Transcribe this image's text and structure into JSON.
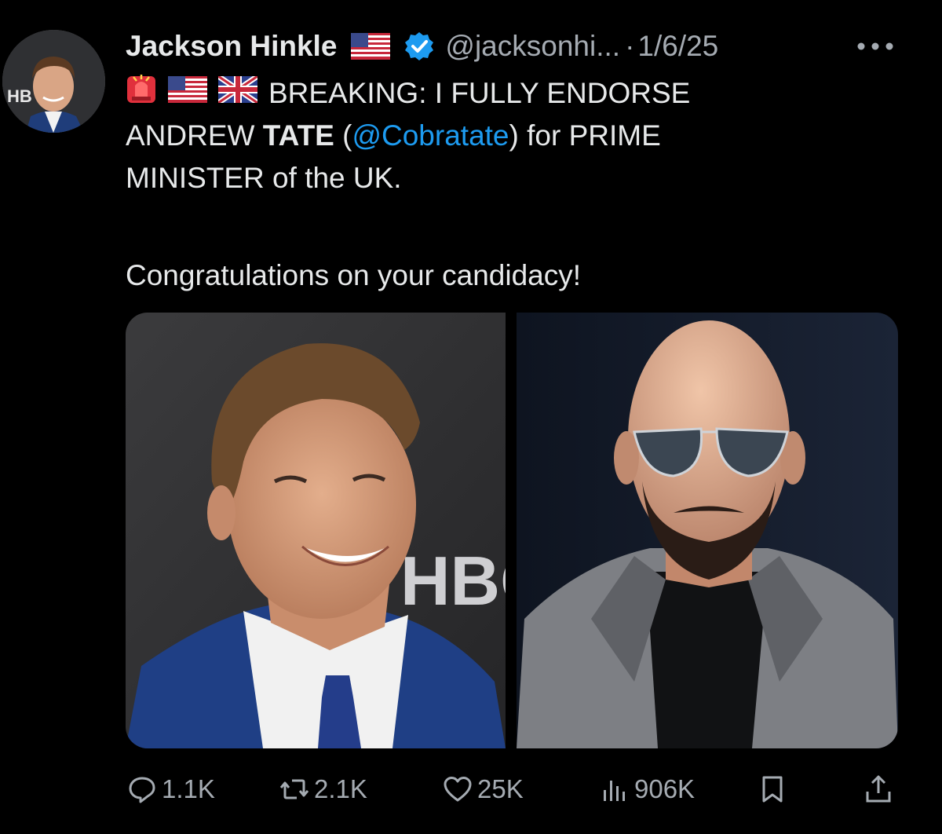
{
  "tweet": {
    "author": {
      "display_name": "Jackson Hinkle",
      "handle": "@jacksonhi...",
      "separator": "·",
      "date": "1/6/25"
    },
    "text": {
      "line1": "BREAKING: I FULLY ENDORSE",
      "line2_prefix": "ANDREW ",
      "line2_bold": "TATE",
      "line2_open": " (",
      "line2_mention": "@Cobratate",
      "line2_suffix": ") for PRIME",
      "line3": "MINISTER of the UK.",
      "line4": "Congratulations on your candidacy!"
    },
    "avatar_logo_text": "HB",
    "left_photo_logo_text": "HBO",
    "actions": {
      "replies": "1.1K",
      "reposts": "2.1K",
      "likes": "25K",
      "views": "906K"
    },
    "icons": {
      "verified": "verified-badge-icon",
      "more": "more-options-icon",
      "reply": "reply-icon",
      "repost": "repost-icon",
      "like": "heart-icon",
      "views": "views-icon",
      "bookmark": "bookmark-icon",
      "share": "share-icon"
    },
    "colors": {
      "background": "#000000",
      "text": "#e7e9ea",
      "secondary_text": "#a5abb2",
      "link": "#1d9bf0",
      "verified": "#1d9bf0"
    }
  }
}
